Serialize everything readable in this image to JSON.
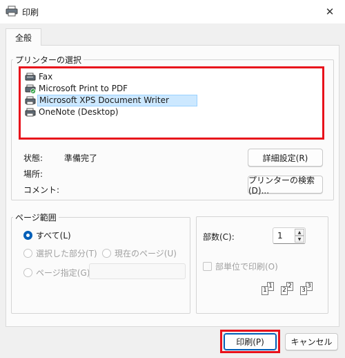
{
  "window": {
    "title": "印刷"
  },
  "tab": {
    "label": "全般"
  },
  "printer_group": {
    "legend": "プリンターの選択",
    "printers": [
      {
        "name": "Fax",
        "icon": "fax-icon"
      },
      {
        "name": "Microsoft Print to PDF",
        "icon": "printer-default-icon"
      },
      {
        "name": "Microsoft XPS Document Writer",
        "icon": "printer-icon",
        "selected": true
      },
      {
        "name": "OneNote (Desktop)",
        "icon": "printer-icon"
      }
    ]
  },
  "status": {
    "status_label": "状態:",
    "status_value": "準備完了",
    "location_label": "場所:",
    "comment_label": "コメント:"
  },
  "buttons": {
    "preferences": "詳細設定(R)",
    "find_printer": "プリンターの検索(D)...",
    "print": "印刷(P)",
    "cancel": "キャンセル"
  },
  "page_range": {
    "legend": "ページ範囲",
    "all": "すべて(L)",
    "selection": "選択した部分(T)",
    "current_page": "現在のページ(U)",
    "pages": "ページ指定(G):",
    "pages_value": ""
  },
  "copies": {
    "label": "部数(C):",
    "value": "1",
    "collate": "部単位で印刷(O)"
  },
  "colors": {
    "accent": "#005fb8",
    "highlight": "#e8111b",
    "selected_row": "#cce8ff"
  }
}
